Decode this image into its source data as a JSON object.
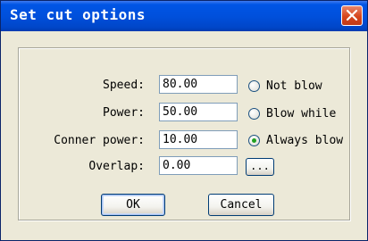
{
  "window": {
    "title": "Set cut options"
  },
  "fields": [
    {
      "label": "Speed:",
      "value": "80.00"
    },
    {
      "label": "Power:",
      "value": "50.00"
    },
    {
      "label": "Conner power:",
      "value": "10.00"
    },
    {
      "label": "Overlap:",
      "value": "0.00"
    }
  ],
  "blow_options": [
    {
      "label": "Not blow",
      "selected": false
    },
    {
      "label": "Blow while",
      "selected": false
    },
    {
      "label": "Always blow",
      "selected": true
    }
  ],
  "buttons": {
    "browse_label": "...",
    "ok_label": "OK",
    "cancel_label": "Cancel"
  },
  "colors": {
    "titlebar": "#0050dc",
    "dialog_background": "#ece9d8",
    "close_button": "#d6451c",
    "radio_selected_dot": "#21a121"
  },
  "icons": {
    "close": "close-icon"
  }
}
